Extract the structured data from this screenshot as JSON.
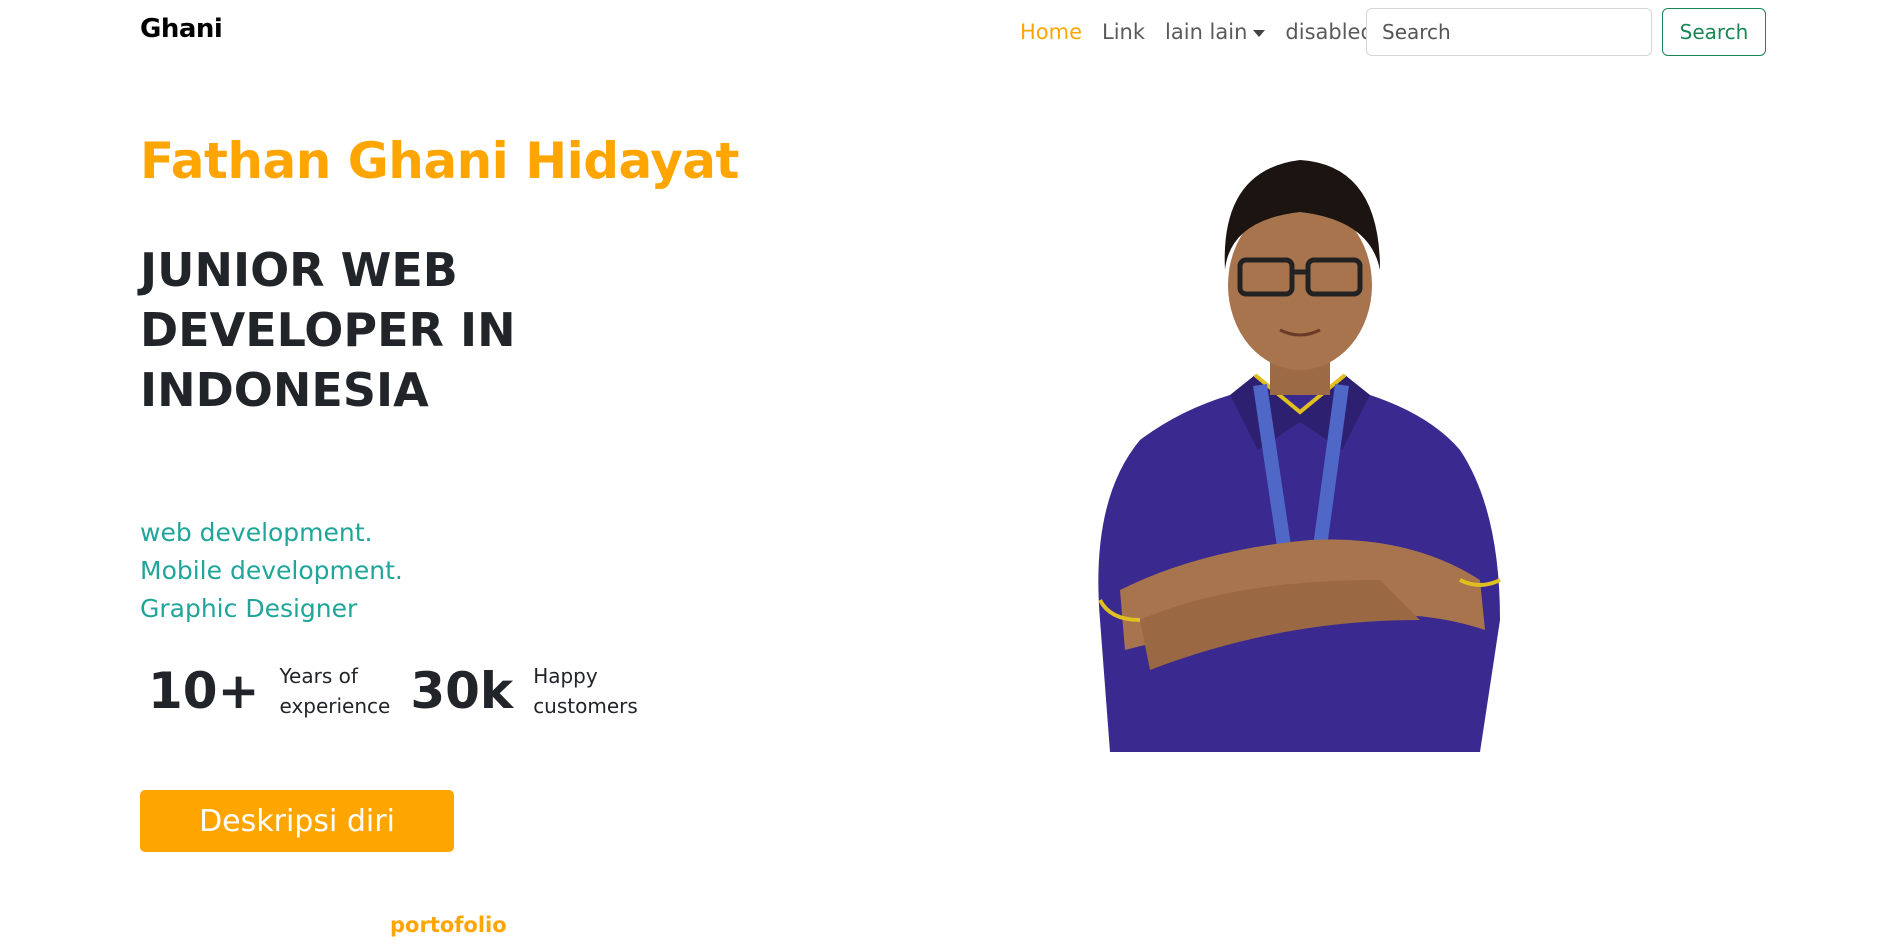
{
  "navbar": {
    "brand": "Ghani",
    "links": [
      {
        "label": "Home",
        "active": true
      },
      {
        "label": "Link",
        "active": false
      },
      {
        "label": "lain lain",
        "active": false,
        "dropdown": true
      },
      {
        "label": "disabled",
        "active": false
      }
    ],
    "search": {
      "placeholder": "Search",
      "button_label": "Search"
    }
  },
  "hero": {
    "name": "Fathan Ghani Hidayat",
    "heading": "JUNIOR WEB DEVELOPER IN INDONESIA",
    "skills": [
      "web development.",
      "Mobile development.",
      "Graphic Designer"
    ],
    "stats": [
      {
        "value": "10+",
        "label_line1": "Years of",
        "label_line2": "experience"
      },
      {
        "value": "30k",
        "label_line1": "Happy",
        "label_line2": "customers"
      }
    ],
    "cta_label": "Deskripsi diri",
    "portfolio_label": "portofolio"
  },
  "colors": {
    "accent": "#ffa500",
    "skills": "#20a59a",
    "search_outline": "#198754",
    "uniform": "#3a2a8f"
  }
}
